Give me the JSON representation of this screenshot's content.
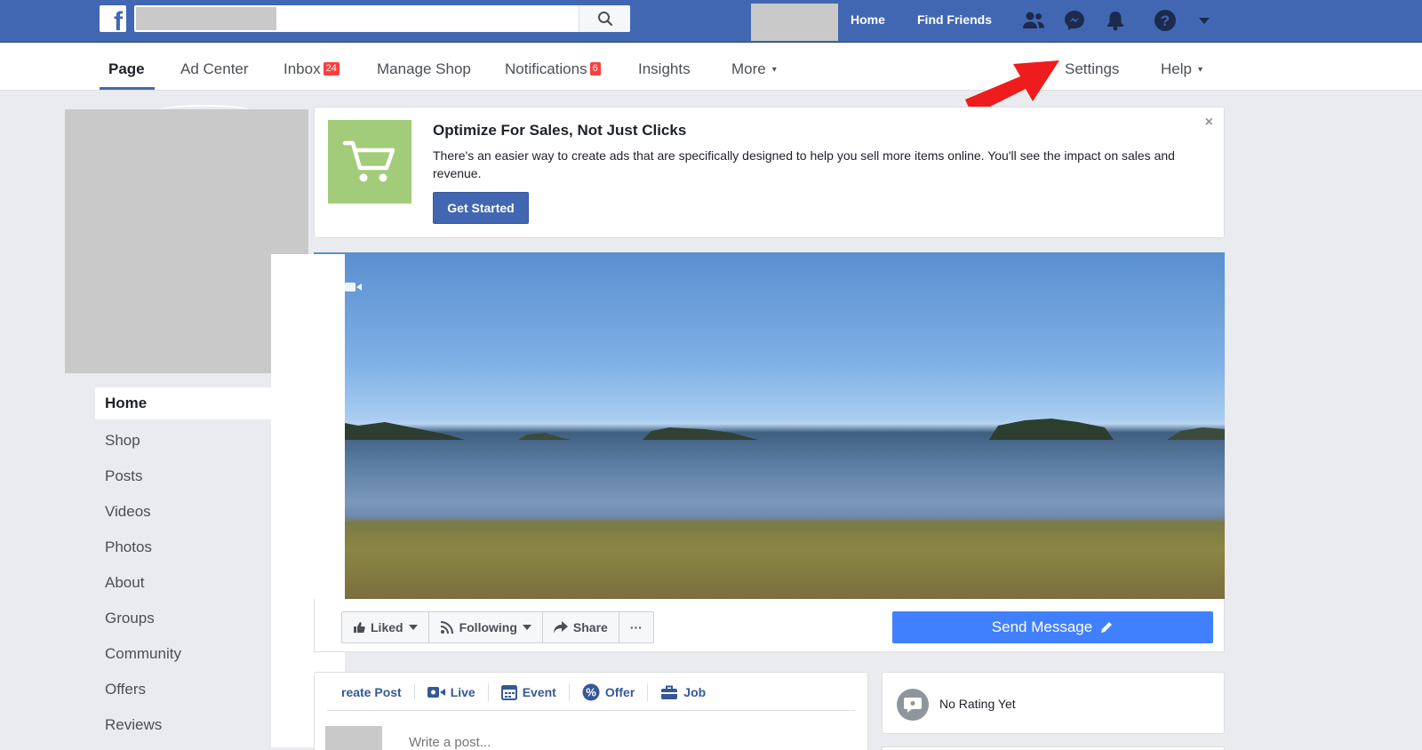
{
  "topbar": {
    "logo": "f",
    "search": {
      "placeholder": "",
      "value": ""
    },
    "links": {
      "home": "Home",
      "find_friends": "Find Friends"
    },
    "icons": [
      "friend-requests-icon",
      "messenger-icon",
      "notifications-bell-icon",
      "help-icon",
      "account-menu-caret-icon"
    ]
  },
  "page_nav": {
    "items": [
      {
        "label": "Page",
        "active": true
      },
      {
        "label": "Ad Center"
      },
      {
        "label": "Inbox",
        "badge": "24"
      },
      {
        "label": "Manage Shop"
      },
      {
        "label": "Notifications",
        "badge": "6"
      },
      {
        "label": "Insights"
      },
      {
        "label": "More",
        "caret": "▾"
      },
      {
        "label": "Settings"
      },
      {
        "label": "Help",
        "caret": "▾"
      }
    ]
  },
  "sidebar": {
    "items": [
      {
        "label": "Home",
        "active": true
      },
      {
        "label": "Shop"
      },
      {
        "label": "Posts"
      },
      {
        "label": "Videos"
      },
      {
        "label": "Photos"
      },
      {
        "label": "About"
      },
      {
        "label": "Groups"
      },
      {
        "label": "Community"
      },
      {
        "label": "Offers"
      },
      {
        "label": "Reviews"
      }
    ]
  },
  "promo": {
    "title": "Optimize For Sales, Not Just Clicks",
    "text": "There's an easier way to create ads that are specifically designed to help you sell more items online. You'll see the impact on sales and revenue.",
    "button": "Get Started",
    "close": "×"
  },
  "actions": {
    "liked": "Liked",
    "following": "Following",
    "share": "Share",
    "more": "···",
    "send_message": "Send Message"
  },
  "composer": {
    "tabs": [
      "reate Post",
      "Live",
      "Event",
      "Offer",
      "Job"
    ],
    "placeholder": "Write a post..."
  },
  "rating": {
    "text": "No Rating Yet"
  },
  "colors": {
    "brand_blue": "#4267b2",
    "send_blue": "#4080ff",
    "badge_red": "#fa3e3e",
    "promo_green": "#a3cc7a",
    "arrow_red": "#ee1c1c"
  }
}
